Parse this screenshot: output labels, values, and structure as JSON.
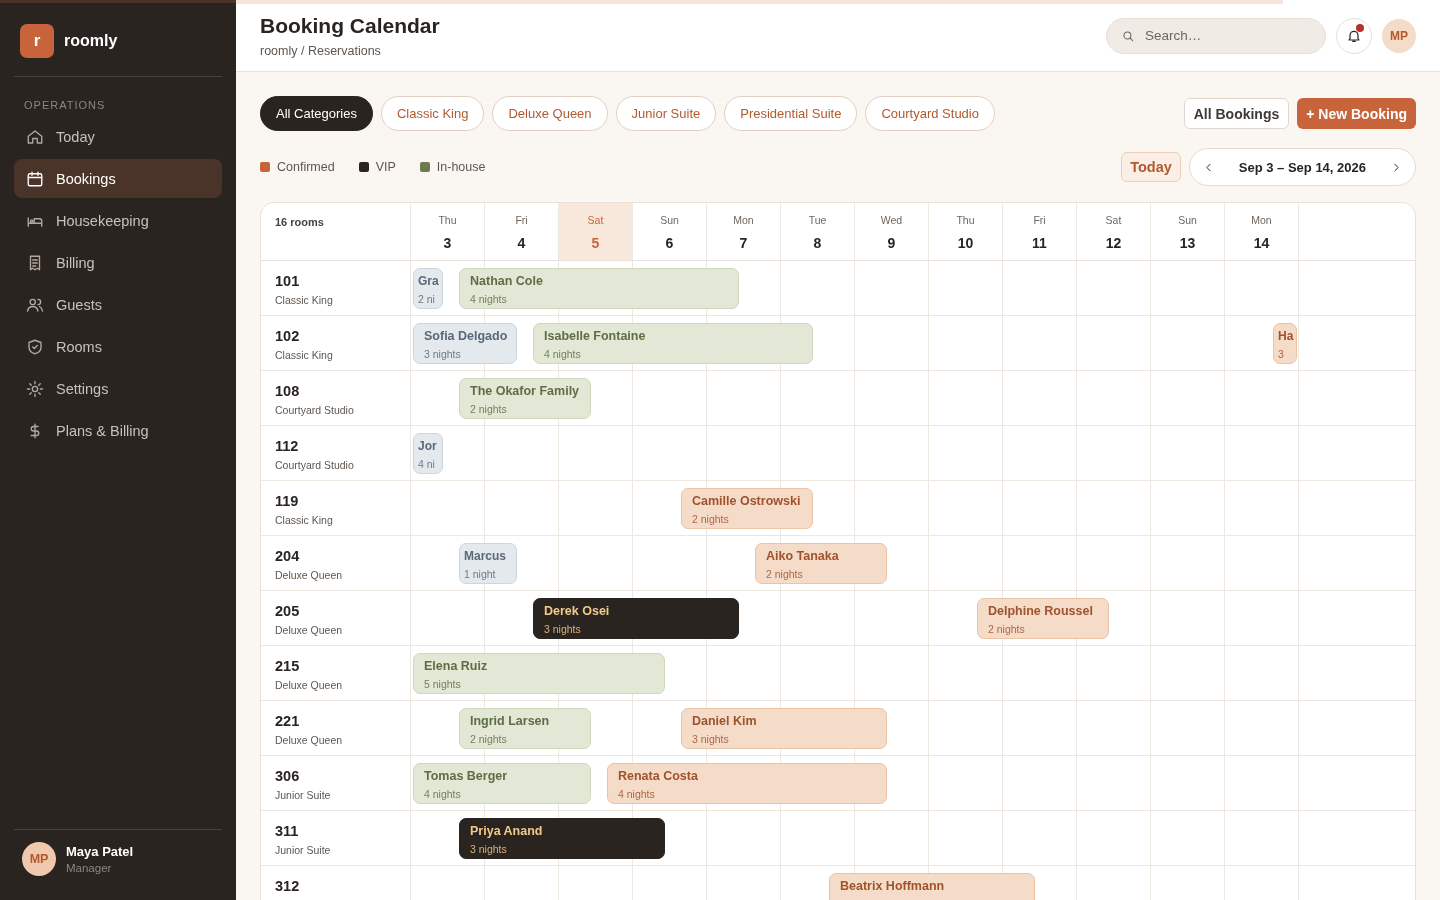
{
  "top_progress": {
    "level": 0.87
  },
  "sidebar": {
    "logo_mark": "r",
    "brand": "roomly",
    "section": "OPERATIONS",
    "items": [
      {
        "label": "Today",
        "selected": false
      },
      {
        "label": "Bookings",
        "selected": true
      },
      {
        "label": "Housekeeping",
        "selected": false
      },
      {
        "label": "Billing",
        "selected": false
      },
      {
        "label": "Guests",
        "selected": false
      },
      {
        "label": "Rooms",
        "selected": false
      },
      {
        "label": "Settings",
        "selected": false
      },
      {
        "label": "Plans & Billing",
        "selected": false
      }
    ],
    "user": {
      "initials": "MP",
      "name": "Maya Patel",
      "role": "Manager"
    }
  },
  "header": {
    "title": "Booking Calendar",
    "breadcrumb": "roomly / Reservations",
    "search": {
      "placeholder": "Search…"
    },
    "notification_dot": true,
    "avatar": "MP"
  },
  "categories": [
    {
      "label": "All Categories",
      "selected": true
    },
    {
      "label": "Classic King",
      "selected": false
    },
    {
      "label": "Deluxe Queen",
      "selected": false
    },
    {
      "label": "Junior Suite",
      "selected": false
    },
    {
      "label": "Presidential Suite",
      "selected": false
    },
    {
      "label": "Courtyard Studio",
      "selected": false
    }
  ],
  "actions": {
    "secondary": "All Bookings",
    "primary": "+ New Booking"
  },
  "legend": [
    {
      "label": "Confirmed",
      "color": "#c8643c"
    },
    {
      "label": "VIP",
      "color": "#2a2420"
    },
    {
      "label": "In-house",
      "color": "#6b7d4e"
    }
  ],
  "today_button": "Today",
  "range": "Sep 3 – Sep 14, 2026",
  "calendar": {
    "rooms_count": "16 rooms",
    "days": [
      {
        "weekday": "Thu",
        "day": "3",
        "today": false
      },
      {
        "weekday": "Fri",
        "day": "4",
        "today": false
      },
      {
        "weekday": "Sat",
        "day": "5",
        "today": true
      },
      {
        "weekday": "Sun",
        "day": "6",
        "today": false
      },
      {
        "weekday": "Mon",
        "day": "7",
        "today": false
      },
      {
        "weekday": "Tue",
        "day": "8",
        "today": false
      },
      {
        "weekday": "Wed",
        "day": "9",
        "today": false
      },
      {
        "weekday": "Thu",
        "day": "10",
        "today": false
      },
      {
        "weekday": "Fri",
        "day": "11",
        "today": false
      },
      {
        "weekday": "Sat",
        "day": "12",
        "today": false
      },
      {
        "weekday": "Sun",
        "day": "13",
        "today": false
      },
      {
        "weekday": "Mon",
        "day": "14",
        "today": false
      }
    ],
    "rooms": [
      {
        "number": "101",
        "type": "Classic King",
        "cells": [
          {
            "kind": "swap"
          },
          {
            "kind": "stay"
          },
          {
            "kind": "stay"
          },
          {
            "kind": "stay"
          },
          {
            "kind": "out"
          },
          {
            "kind": "free"
          },
          {
            "kind": "free"
          },
          {
            "kind": "free"
          },
          {
            "kind": "free"
          },
          {
            "kind": "free"
          },
          {
            "kind": "free"
          },
          {
            "kind": "free"
          }
        ],
        "bookings": [
          {
            "guest": "Gra",
            "nights": "2 ni",
            "kind": "past"
          },
          {
            "guest": "Nathan Cole",
            "nights": "4 nights",
            "kind": "in_house"
          }
        ]
      },
      {
        "number": "102",
        "type": "Classic King",
        "cells": [
          {
            "kind": "stay"
          },
          {
            "kind": "swap"
          },
          {
            "kind": "stay"
          },
          {
            "kind": "stay"
          },
          {
            "kind": "stay"
          },
          {
            "kind": "out"
          },
          {
            "kind": "free"
          },
          {
            "kind": "free"
          },
          {
            "kind": "free"
          },
          {
            "kind": "free"
          },
          {
            "kind": "free"
          },
          {
            "kind": "in"
          }
        ],
        "bookings": [
          {
            "guest": "Sofia Delgado",
            "nights": "3 nights",
            "kind": "past"
          },
          {
            "guest": "Isabelle Fontaine",
            "nights": "4 nights",
            "kind": "in_house"
          },
          {
            "guest": "Ha",
            "nights": "3",
            "kind": "confirmed"
          }
        ]
      },
      {
        "number": "108",
        "type": "Courtyard Studio",
        "cells": [
          {
            "kind": "in"
          },
          {
            "kind": "stay"
          },
          {
            "kind": "out"
          },
          {
            "kind": "free"
          },
          {
            "kind": "free"
          },
          {
            "kind": "free"
          },
          {
            "kind": "free"
          },
          {
            "kind": "free"
          },
          {
            "kind": "free"
          },
          {
            "kind": "free"
          },
          {
            "kind": "free"
          },
          {
            "kind": "free"
          }
        ],
        "bookings": [
          {
            "guest": "The Okafor Family",
            "nights": "2 nights",
            "kind": "in_house"
          }
        ]
      },
      {
        "number": "112",
        "type": "Courtyard Studio",
        "cells": [
          {
            "kind": "out"
          },
          {
            "kind": "free"
          },
          {
            "kind": "free"
          },
          {
            "kind": "free"
          },
          {
            "kind": "free"
          },
          {
            "kind": "free"
          },
          {
            "kind": "free"
          },
          {
            "kind": "free"
          },
          {
            "kind": "free"
          },
          {
            "kind": "free"
          },
          {
            "kind": "free"
          },
          {
            "kind": "free"
          }
        ],
        "bookings": [
          {
            "guest": "Jor",
            "nights": "4 ni",
            "kind": "past"
          }
        ]
      },
      {
        "number": "119",
        "type": "Classic King",
        "cells": [
          {
            "kind": "free"
          },
          {
            "kind": "free"
          },
          {
            "kind": "free"
          },
          {
            "kind": "in"
          },
          {
            "kind": "stay"
          },
          {
            "kind": "out"
          },
          {
            "kind": "free"
          },
          {
            "kind": "free"
          },
          {
            "kind": "free"
          },
          {
            "kind": "free"
          },
          {
            "kind": "free"
          },
          {
            "kind": "free"
          }
        ],
        "bookings": [
          {
            "guest": "Camille Ostrowski",
            "nights": "2 nights",
            "kind": "confirmed"
          }
        ]
      },
      {
        "number": "204",
        "type": "Deluxe Queen",
        "cells": [
          {
            "kind": "in"
          },
          {
            "kind": "out"
          },
          {
            "kind": "free"
          },
          {
            "kind": "free"
          },
          {
            "kind": "in"
          },
          {
            "kind": "stay"
          },
          {
            "kind": "out"
          },
          {
            "kind": "free"
          },
          {
            "kind": "free"
          },
          {
            "kind": "free"
          },
          {
            "kind": "free"
          },
          {
            "kind": "free"
          }
        ],
        "bookings": [
          {
            "guest": "Marcus",
            "nights": "1 night",
            "kind": "past"
          },
          {
            "guest": "Aiko Tanaka",
            "nights": "2 nights",
            "kind": "confirmed"
          }
        ]
      },
      {
        "number": "205",
        "type": "Deluxe Queen",
        "cells": [
          {
            "kind": "free"
          },
          {
            "kind": "in"
          },
          {
            "kind": "stay"
          },
          {
            "kind": "stay"
          },
          {
            "kind": "out"
          },
          {
            "kind": "free"
          },
          {
            "kind": "free"
          },
          {
            "kind": "in"
          },
          {
            "kind": "stay"
          },
          {
            "kind": "out"
          },
          {
            "kind": "free"
          },
          {
            "kind": "free"
          }
        ],
        "bookings": [
          {
            "guest": "Derek Osei",
            "nights": "3 nights",
            "kind": "vip"
          },
          {
            "guest": "Delphine Roussel",
            "nights": "2 nights",
            "kind": "confirmed"
          }
        ]
      },
      {
        "number": "215",
        "type": "Deluxe Queen",
        "cells": [
          {
            "kind": "stay"
          },
          {
            "kind": "stay"
          },
          {
            "kind": "stay"
          },
          {
            "kind": "out"
          },
          {
            "kind": "free"
          },
          {
            "kind": "free"
          },
          {
            "kind": "free"
          },
          {
            "kind": "free"
          },
          {
            "kind": "free"
          },
          {
            "kind": "free"
          },
          {
            "kind": "free"
          },
          {
            "kind": "free"
          }
        ],
        "bookings": [
          {
            "guest": "Elena Ruiz",
            "nights": "5 nights",
            "kind": "in_house"
          }
        ]
      },
      {
        "number": "221",
        "type": "Deluxe Queen",
        "cells": [
          {
            "kind": "in"
          },
          {
            "kind": "stay"
          },
          {
            "kind": "out"
          },
          {
            "kind": "in"
          },
          {
            "kind": "stay"
          },
          {
            "kind": "stay"
          },
          {
            "kind": "out"
          },
          {
            "kind": "free"
          },
          {
            "kind": "free"
          },
          {
            "kind": "free"
          },
          {
            "kind": "free"
          },
          {
            "kind": "free"
          }
        ],
        "bookings": [
          {
            "guest": "Ingrid Larsen",
            "nights": "2 nights",
            "kind": "in_house"
          },
          {
            "guest": "Daniel Kim",
            "nights": "3 nights",
            "kind": "confirmed"
          }
        ]
      },
      {
        "number": "306",
        "type": "Junior Suite",
        "cells": [
          {
            "kind": "stay"
          },
          {
            "kind": "stay"
          },
          {
            "kind": "swap"
          },
          {
            "kind": "stay"
          },
          {
            "kind": "stay"
          },
          {
            "kind": "stay"
          },
          {
            "kind": "out"
          },
          {
            "kind": "free"
          },
          {
            "kind": "free"
          },
          {
            "kind": "free"
          },
          {
            "kind": "free"
          },
          {
            "kind": "free"
          }
        ],
        "bookings": [
          {
            "guest": "Tomas Berger",
            "nights": "4 nights",
            "kind": "in_house"
          },
          {
            "guest": "Renata Costa",
            "nights": "4 nights",
            "kind": "confirmed"
          }
        ]
      },
      {
        "number": "311",
        "type": "Junior Suite",
        "cells": [
          {
            "kind": "in"
          },
          {
            "kind": "stay"
          },
          {
            "kind": "stay"
          },
          {
            "kind": "out"
          },
          {
            "kind": "free"
          },
          {
            "kind": "free"
          },
          {
            "kind": "free"
          },
          {
            "kind": "free"
          },
          {
            "kind": "free"
          },
          {
            "kind": "free"
          },
          {
            "kind": "free"
          },
          {
            "kind": "free"
          }
        ],
        "bookings": [
          {
            "guest": "Priya Anand",
            "nights": "3 nights",
            "kind": "vip"
          }
        ]
      },
      {
        "number": "312",
        "cells": [
          {
            "kind": "free"
          },
          {
            "kind": "free"
          },
          {
            "kind": "free"
          },
          {
            "kind": "free"
          },
          {
            "kind": "free"
          },
          {
            "kind": "in"
          },
          {
            "kind": "stay"
          },
          {
            "kind": "stay"
          },
          {
            "kind": "out"
          },
          {
            "kind": "free"
          },
          {
            "kind": "free"
          },
          {
            "kind": "free"
          }
        ],
        "bookings": [
          {
            "guest": "Beatrix Hoffmann",
            "kind": "confirmed"
          }
        ]
      }
    ]
  }
}
